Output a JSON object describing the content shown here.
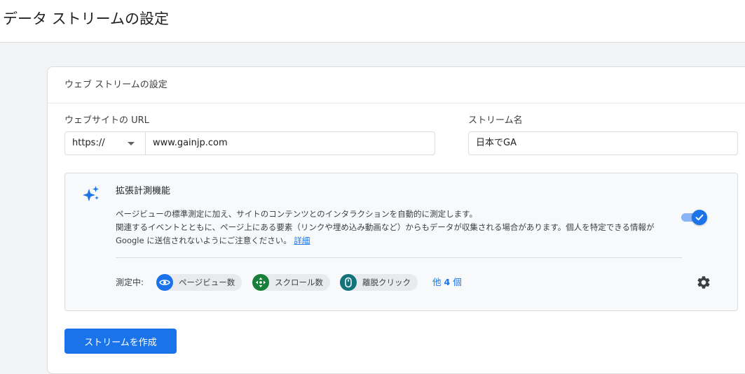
{
  "page": {
    "title": "データ ストリームの設定"
  },
  "card": {
    "title": "ウェブ ストリームの設定",
    "website_url": {
      "label": "ウェブサイトの URL",
      "protocol": "https://",
      "value": "www.gainjp.com"
    },
    "stream_name": {
      "label": "ストリーム名",
      "value": "日本でGA"
    },
    "enhanced_measurement": {
      "title": "拡張計測機能",
      "description_line1": "ページビューの標準測定に加え、サイトのコンテンツとのインタラクションを自動的に測定します。",
      "description_line2": "関連するイベントとともに、ページ上にある要素（リンクや埋め込み動画など）からもデータが収集される場合があります。個人を特定できる情報が Google に送信されないようにご注意ください。",
      "learn_more": "詳細",
      "enabled": true,
      "measuring_label": "測定中:",
      "chips": [
        {
          "label": "ページビュー数",
          "icon": "eye-icon",
          "color": "#1a73e8"
        },
        {
          "label": "スクロール数",
          "icon": "scroll-arrows-icon",
          "color": "#188038"
        },
        {
          "label": "離脱クリック",
          "icon": "mouse-icon",
          "color": "#12737a"
        }
      ],
      "more_prefix": "他",
      "more_count": "4",
      "more_suffix": "個"
    },
    "create_button": "ストリームを作成"
  },
  "colors": {
    "accent": "#1a73e8",
    "toggle_track": "#8ab4f8",
    "page_background": "#f1f3f4",
    "panel_background": "#f8f9fa"
  }
}
